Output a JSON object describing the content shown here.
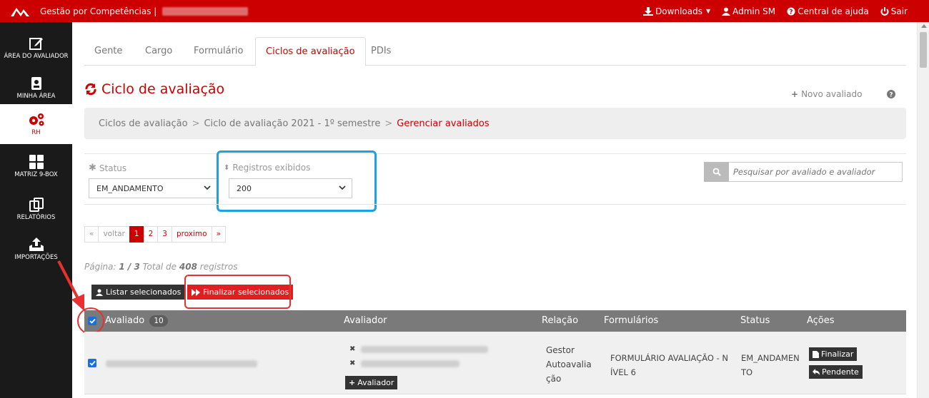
{
  "topbar": {
    "app_title": "Gestão por Competências |",
    "downloads": "Downloads",
    "admin": "Admin SM",
    "help": "Central de ajuda",
    "logout": "Sair"
  },
  "sidebar": {
    "items": [
      {
        "label": "ÁREA DO AVALIADOR",
        "icon": "edit-icon"
      },
      {
        "label": "MINHA ÁREA",
        "icon": "id-card-icon"
      },
      {
        "label": "RH",
        "icon": "gears-icon"
      },
      {
        "label": "MATRIZ 9-BOX",
        "icon": "grid-icon"
      },
      {
        "label": "RELATÓRIOS",
        "icon": "copy-icon"
      },
      {
        "label": "IMPORTAÇÕES",
        "icon": "upload-icon"
      }
    ]
  },
  "tabs": [
    "Gente",
    "Cargo",
    "Formulário",
    "Ciclos de avaliação",
    "PDIs"
  ],
  "page": {
    "title": "Ciclo de avaliação",
    "new_evaluated": "Novo avaliado"
  },
  "breadcrumb": {
    "items": [
      "Ciclos de avaliação",
      "Ciclo de avaliação 2021 - 1º semestre",
      "Gerenciar avaliados"
    ],
    "sep": ">"
  },
  "filters": {
    "status_label": "Status",
    "status_value": "EM_ANDAMENTO",
    "records_label": "Registros exibidos",
    "records_value": "200",
    "search_placeholder": "Pesquisar por avaliado e avaliador"
  },
  "pager": {
    "first": "«",
    "prev": "voltar",
    "pages": [
      "1",
      "2",
      "3"
    ],
    "next": "proximo",
    "last": "»"
  },
  "page_info": {
    "prefix": "Página:",
    "current": "1 / 3",
    "total_prefix": "Total de",
    "total": "408",
    "total_suffix": "registros"
  },
  "actions": {
    "list_selected": "Listar selecionados",
    "finalize_selected": "Finalizar selecionados"
  },
  "table": {
    "headers": {
      "evaluated": "Avaliado",
      "evaluated_count": "10",
      "evaluator": "Avaliador",
      "relation": "Relação",
      "forms": "Formulários",
      "status": "Status",
      "actions": "Ações"
    },
    "rows": [
      {
        "relations": [
          "Gestor",
          "Autoavalia",
          "ção"
        ],
        "form_lines": [
          "FORMULÁRIO AVALIAÇÃO - N",
          "ÍVEL 6"
        ],
        "status_lines": [
          "EM_ANDAMEN",
          "TO"
        ],
        "add_evaluator": "Avaliador",
        "finalize": "Finalizar",
        "pending": "Pendente"
      }
    ]
  },
  "colors": {
    "brand_red": "#cc0000",
    "sidebar_bg": "#1a1a1a",
    "highlight_blue": "#1da1e0",
    "header_gray": "#7a7a7a"
  }
}
